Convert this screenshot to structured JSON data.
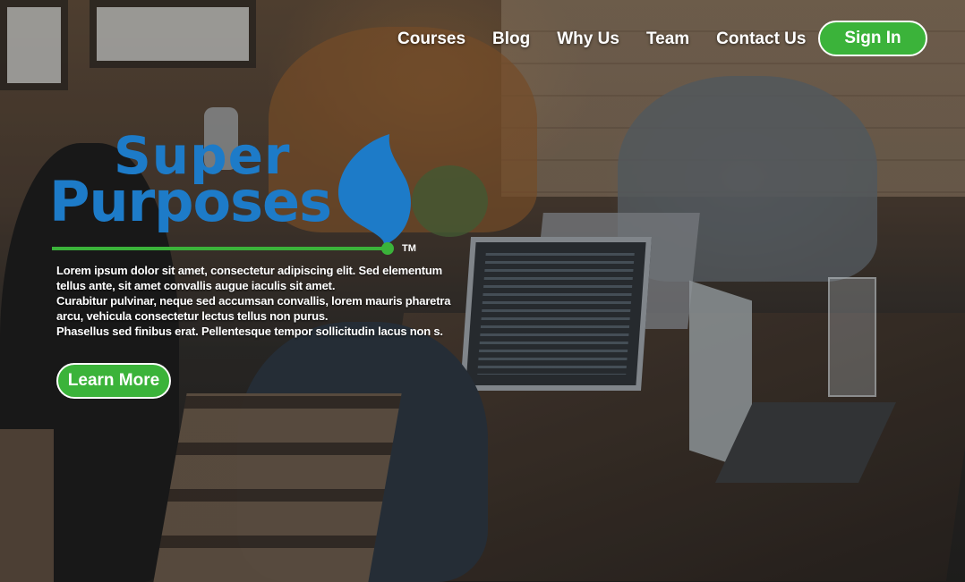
{
  "nav": {
    "items": [
      {
        "label": "Courses"
      },
      {
        "label": "Blog"
      },
      {
        "label": "Why Us"
      },
      {
        "label": "Team"
      },
      {
        "label": "Contact Us"
      }
    ],
    "sign_in_label": "Sign In"
  },
  "logo": {
    "line1": "Super",
    "line2": "Purposes",
    "trademark": "TM",
    "colors": {
      "text": "#1d7bc8",
      "underline": "#3bb33a"
    }
  },
  "hero": {
    "paragraphs": [
      "Lorem ipsum dolor sit amet, consectetur adipiscing elit. Sed elementum tellus ante, sit amet convallis augue iaculis sit amet.",
      "Curabitur pulvinar, neque sed accumsan convallis, lorem mauris pharetra arcu, vehicula consectetur lectus tellus non purus.",
      "Phasellus sed finibus erat. Pellentesque tempor sollicitudin lacus non s."
    ],
    "cta_label": "Learn More"
  },
  "colors": {
    "accent": "#3bb33a",
    "brand": "#1d7bc8"
  }
}
